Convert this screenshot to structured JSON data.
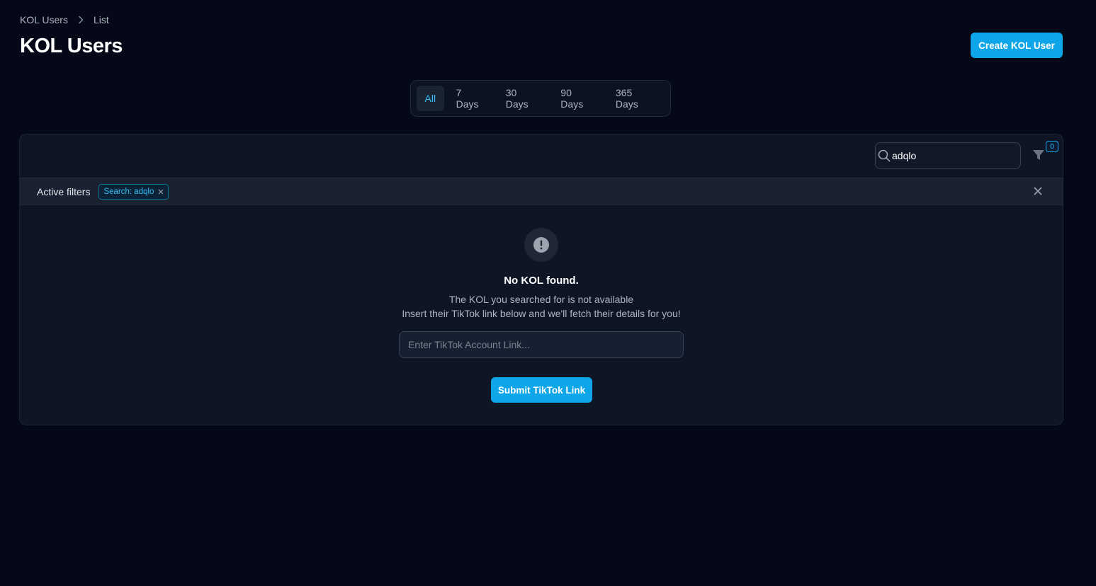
{
  "breadcrumb": {
    "items": [
      "KOL Users",
      "List"
    ]
  },
  "page": {
    "title": "KOL Users"
  },
  "header": {
    "create_button_label": "Create KOL User"
  },
  "range_tabs": {
    "items": [
      "All",
      "7 Days",
      "30 Days",
      "90 Days",
      "365 Days"
    ],
    "selected": "All"
  },
  "toolbar": {
    "search_value": "adqlo",
    "filter_count": "0"
  },
  "active_filters": {
    "label": "Active filters",
    "chips": [
      "Search: adqlo"
    ]
  },
  "empty_state": {
    "title": "No KOL found.",
    "line1": "The KOL you searched for is not available",
    "line2": "Insert their TikTok link below and we'll fetch their details for you!",
    "input_placeholder": "Enter TikTok Account Link...",
    "submit_label": "Submit TikTok Link"
  },
  "colors": {
    "background": "#050816",
    "panel": "#0e1626",
    "accent": "#0ea5e9",
    "accent_text": "#38bdf8"
  },
  "icons": [
    "chevron-right-icon",
    "search-icon",
    "filter-icon",
    "close-icon",
    "alert-circle-icon"
  ]
}
